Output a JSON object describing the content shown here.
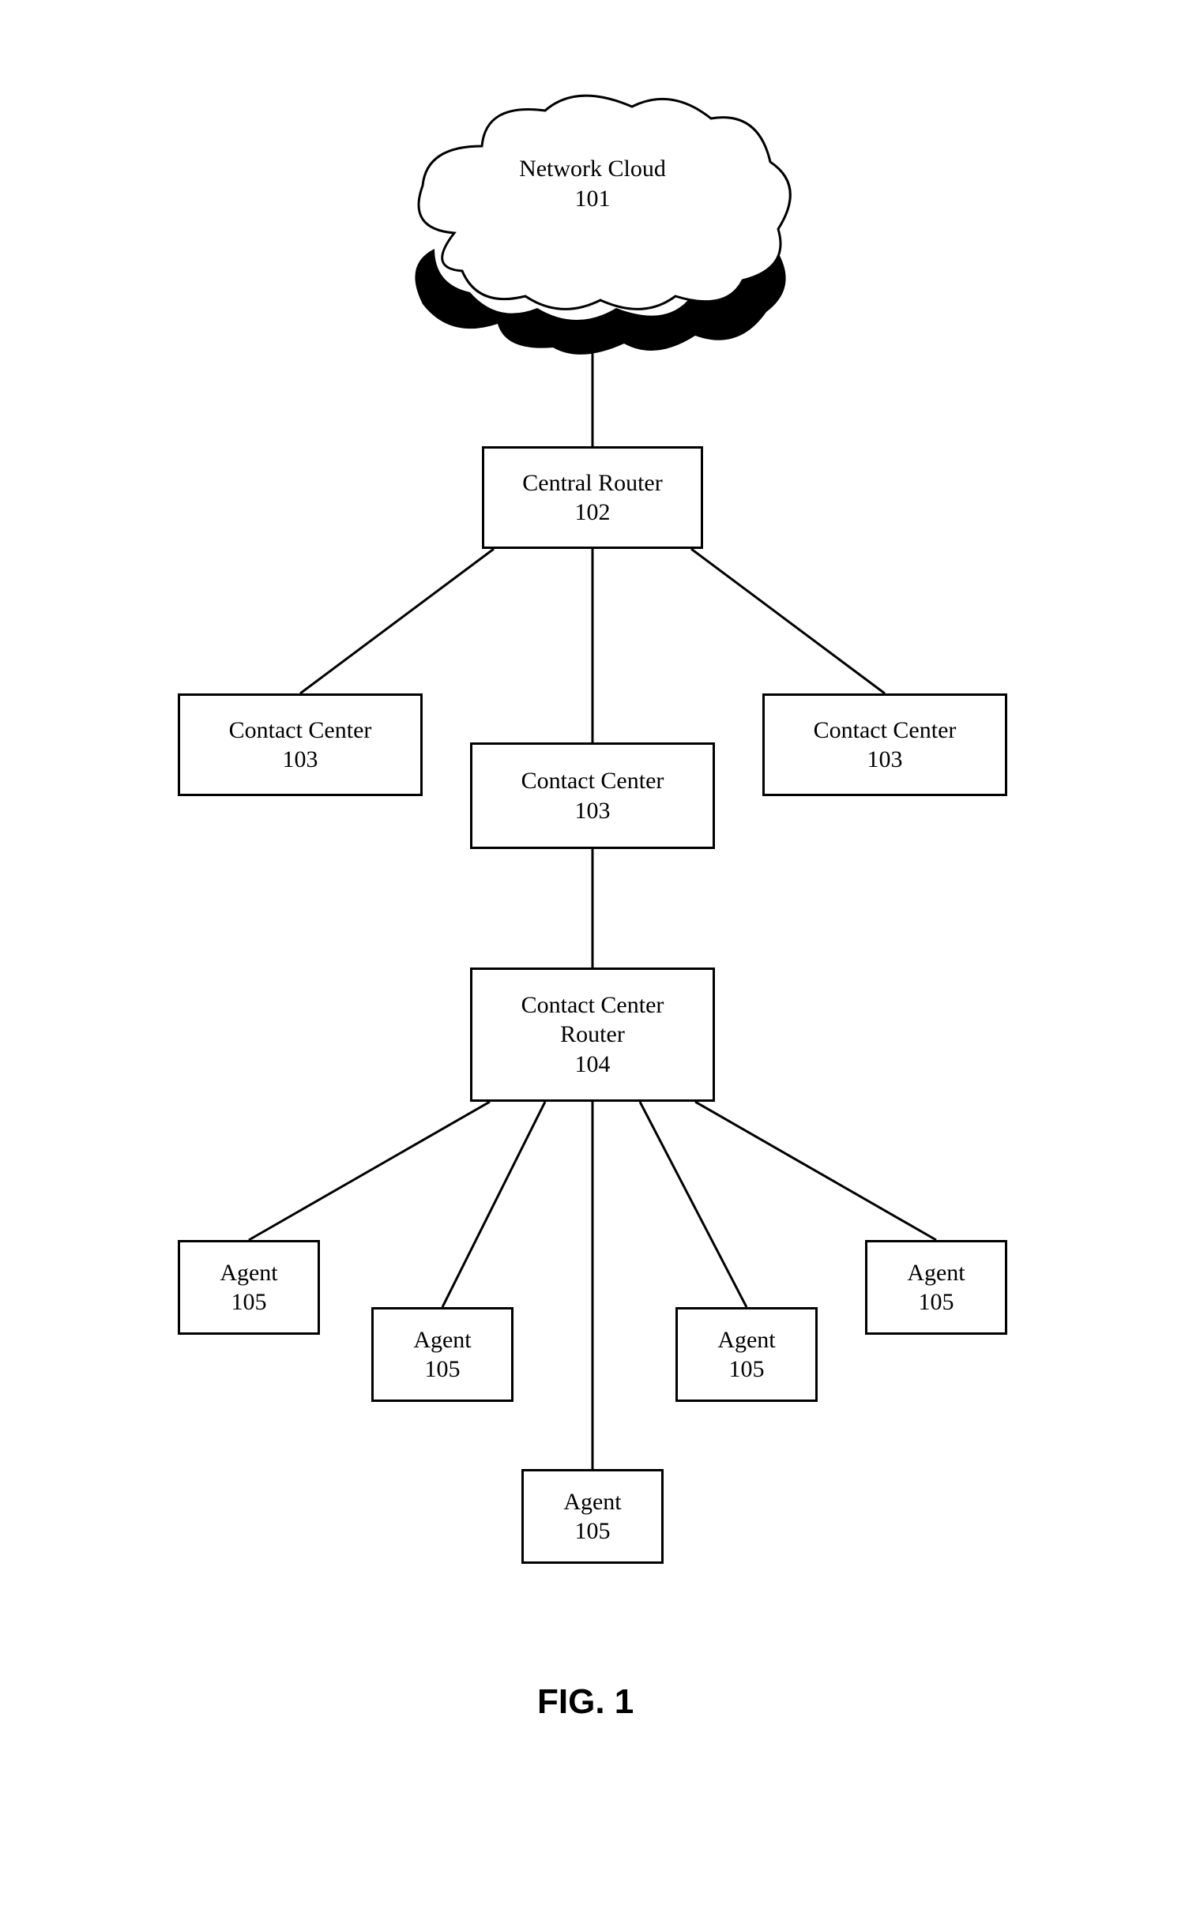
{
  "diagram": {
    "figure_label": "FIG. 1",
    "nodes": {
      "cloud": {
        "label": "Network Cloud",
        "ref": "101"
      },
      "router": {
        "label": "Central Router",
        "ref": "102"
      },
      "cc_left": {
        "label": "Contact Center",
        "ref": "103"
      },
      "cc_mid": {
        "label": "Contact Center",
        "ref": "103"
      },
      "cc_right": {
        "label": "Contact Center",
        "ref": "103"
      },
      "cc_router": {
        "label1": "Contact Center",
        "label2": "Router",
        "ref": "104"
      },
      "agent_1": {
        "label": "Agent",
        "ref": "105"
      },
      "agent_2": {
        "label": "Agent",
        "ref": "105"
      },
      "agent_3": {
        "label": "Agent",
        "ref": "105"
      },
      "agent_4": {
        "label": "Agent",
        "ref": "105"
      },
      "agent_5": {
        "label": "Agent",
        "ref": "105"
      }
    }
  }
}
